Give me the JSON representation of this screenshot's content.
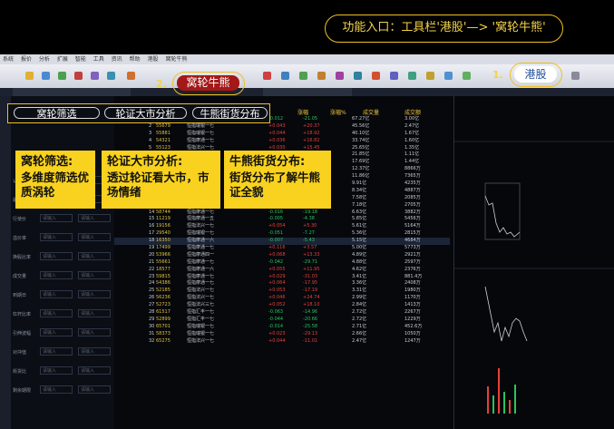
{
  "header_caption": "功能入口：工具栏'港股'—> '窝轮牛熊'",
  "steps": {
    "step1_number": "1.",
    "step1_label": "港股",
    "step2_number": "2.",
    "step2_label": "窝轮牛熊"
  },
  "menubar": [
    "系统",
    "报价",
    "分析",
    "扩展",
    "智能",
    "工具",
    "资讯",
    "帮助",
    "港股",
    "窝轮牛熊"
  ],
  "subtabs": {
    "tab1": "窝轮筛选",
    "tab2": "轮证大市分析",
    "tab3": "牛熊街货分布"
  },
  "callouts": {
    "c1_title": "窝轮筛选:",
    "c1_body": "多维度筛选优质涡轮",
    "c2_title": "轮证大市分析:",
    "c2_body": "透过轮证看大市，市场情绪",
    "c3_title": "牛熊街货分布:",
    "c3_body": "街货分布了解牛熊证全貌"
  },
  "table_headers": [
    "涨幅",
    "涨幅%",
    "成交量",
    "成交额"
  ],
  "filter_labels": [
    "认购证",
    "最新价",
    "行使价",
    "溢价率",
    "换股比率",
    "成交量",
    "到期日",
    "杠杆比率",
    "引伸波幅",
    "对冲值",
    "街货比",
    "剩余期限"
  ],
  "filter_placeholder": "请输入",
  "colors": {
    "highlight": "#f0c020",
    "callout_bg": "#f8d21e",
    "up": "#e8403a",
    "down": "#29c45a"
  },
  "rows": [
    {
      "n": "1",
      "code": "55680",
      "name": "恒指瑞银一七",
      "chg": "-0.012",
      "pct": "-21.05",
      "vol": "67.27亿",
      "amt": "3.00亿"
    },
    {
      "n": "2",
      "code": "55679",
      "name": "恒指瑞银一七",
      "chg": "+0.043",
      "pct": "+20.37",
      "vol": "45.56亿",
      "amt": "2.47亿"
    },
    {
      "n": "3",
      "code": "55881",
      "name": "恒指瑞银一七",
      "chg": "+0.044",
      "pct": "+18.92",
      "vol": "40.10亿",
      "amt": "1.67亿"
    },
    {
      "n": "4",
      "code": "54321",
      "name": "恒指摩通一七",
      "chg": "+0.036",
      "pct": "+16.82",
      "vol": "33.74亿",
      "amt": "1.60亿"
    },
    {
      "n": "5",
      "code": "55123",
      "name": "恒指法兴一七",
      "chg": "+0.030",
      "pct": "+15.45",
      "vol": "25.65亿",
      "amt": "1.35亿"
    },
    {
      "n": "6",
      "code": "54987",
      "name": "恒指法巴一七",
      "chg": "+0.027",
      "pct": "+14.13",
      "vol": "21.85亿",
      "amt": "1.11亿"
    },
    {
      "n": "7",
      "code": "55001",
      "name": "恒指汇丰一七",
      "chg": "-0.025",
      "pct": "-13.31",
      "vol": "17.69亿",
      "amt": "1.44亿"
    },
    {
      "n": "8",
      "code": "54678",
      "name": "恒指高盛一七",
      "chg": "+0.021",
      "pct": "+12.04",
      "vol": "12.37亿",
      "amt": "8866万"
    },
    {
      "n": "9",
      "code": "54790",
      "name": "恒指摩通一七",
      "chg": "+0.019",
      "pct": "+10.38",
      "vol": "11.86亿",
      "amt": "7365万"
    },
    {
      "n": "10",
      "code": "55234",
      "name": "恒指瑞银一七",
      "chg": "+0.017",
      "pct": "+9.04",
      "vol": "9.91亿",
      "amt": "4235万"
    },
    {
      "n": "11",
      "code": "54857",
      "name": "恒指摩通一七",
      "chg": "+0.060",
      "pct": "+15.38",
      "vol": "8.34亿",
      "amt": "4887万"
    },
    {
      "n": "12",
      "code": "29939",
      "name": "恒指瑞银一七",
      "chg": "+0.026",
      "pct": "+8.45",
      "vol": "7.58亿",
      "amt": "2085万"
    },
    {
      "n": "13",
      "code": "65305",
      "name": "恒指瑞银一七",
      "chg": "-0.017",
      "pct": "-35.42",
      "vol": "7.18亿",
      "amt": "2705万"
    },
    {
      "n": "14",
      "code": "58744",
      "name": "恒指摩通一七",
      "chg": "-0.016",
      "pct": "-19.18",
      "vol": "6.63亿",
      "amt": "3882万"
    },
    {
      "n": "15",
      "code": "11219",
      "name": "恒指摩通一五",
      "chg": "-0.005",
      "pct": "-4.38",
      "vol": "5.85亿",
      "amt": "5456万"
    },
    {
      "n": "16",
      "code": "19156",
      "name": "恒指法兴一七",
      "chg": "+0.054",
      "pct": "+5.30",
      "vol": "5.61亿",
      "amt": "5164万"
    },
    {
      "n": "17",
      "code": "29540",
      "name": "恒指瑞银一七",
      "chg": "-0.051",
      "pct": "-7.27",
      "vol": "5.36亿",
      "amt": "2815万"
    },
    {
      "n": "18",
      "code": "16350",
      "name": "恒指摩通一六",
      "chg": "-0.007",
      "pct": "-5.43",
      "vol": "5.15亿",
      "amt": "4684万"
    },
    {
      "n": "19",
      "code": "17499",
      "name": "恒指摩通一七",
      "chg": "+0.116",
      "pct": "+3.57",
      "vol": "5.00亿",
      "amt": "5773万"
    },
    {
      "n": "20",
      "code": "53966",
      "name": "恒指摩通四一",
      "chg": "+0.068",
      "pct": "+13.33",
      "vol": "4.89亿",
      "amt": "2921万"
    },
    {
      "n": "21",
      "code": "55661",
      "name": "恒指摩通一七",
      "chg": "-0.042",
      "pct": "-29.71",
      "vol": "4.88亿",
      "amt": "2597万"
    },
    {
      "n": "22",
      "code": "18577",
      "name": "恒指摩通一六",
      "chg": "+0.055",
      "pct": "+11.95",
      "vol": "4.62亿",
      "amt": "2376万"
    },
    {
      "n": "23",
      "code": "59815",
      "name": "恒指摩通一七",
      "chg": "+0.029",
      "pct": "-31.03",
      "vol": "3.41亿",
      "amt": "881.4万"
    },
    {
      "n": "24",
      "code": "54386",
      "name": "恒指摩通一七",
      "chg": "+0.064",
      "pct": "-17.95",
      "vol": "3.36亿",
      "amt": "2408万"
    },
    {
      "n": "25",
      "code": "52185",
      "name": "恒指法兴一七",
      "chg": "+0.053",
      "pct": "-17.19",
      "vol": "3.31亿",
      "amt": "1980万"
    },
    {
      "n": "26",
      "code": "56236",
      "name": "恒指法兴一七",
      "chg": "+0.046",
      "pct": "+24.74",
      "vol": "2.99亿",
      "amt": "1170万"
    },
    {
      "n": "27",
      "code": "52723",
      "name": "恒指法兴三七",
      "chg": "+0.052",
      "pct": "+18.10",
      "vol": "2.84亿",
      "amt": "1413万"
    },
    {
      "n": "28",
      "code": "61517",
      "name": "恒指汇丰一七",
      "chg": "-0.063",
      "pct": "-14.96",
      "vol": "2.72亿",
      "amt": "2267万"
    },
    {
      "n": "29",
      "code": "52899",
      "name": "恒指汇丰一七",
      "chg": "-0.044",
      "pct": "-20.66",
      "vol": "2.72亿",
      "amt": "1229万"
    },
    {
      "n": "30",
      "code": "65701",
      "name": "恒指瑞银一七",
      "chg": "-0.014",
      "pct": "-25.58",
      "vol": "2.71亿",
      "amt": "452.6万"
    },
    {
      "n": "31",
      "code": "58373",
      "name": "恒指瑞银一七",
      "chg": "+0.023",
      "pct": "-29.13",
      "vol": "2.66亿",
      "amt": "1050万"
    },
    {
      "n": "32",
      "code": "65275",
      "name": "恒指法兴一七",
      "chg": "+0.044",
      "pct": "-11.01",
      "vol": "2.47亿",
      "amt": "1247万"
    }
  ]
}
